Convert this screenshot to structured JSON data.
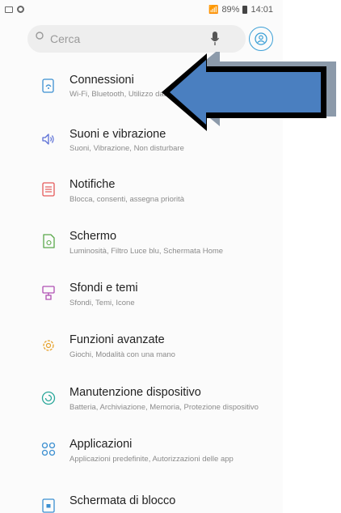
{
  "status_bar": {
    "icons": [
      "image-icon",
      "notification-dot-icon"
    ],
    "signal": "📶",
    "battery_percent": "89%",
    "time": "14:01"
  },
  "search": {
    "placeholder": "Cerca",
    "icons": [
      "search-icon",
      "microphone-icon",
      "profile-icon"
    ]
  },
  "settings_items": [
    {
      "title": "Connessioni",
      "subtitle": "Wi-Fi, Bluetooth, Utilizzo dati, Modalità offline",
      "icon": "connections-icon",
      "color": "#3b8fd1"
    },
    {
      "title": "Suoni e vibrazione",
      "subtitle": "Suoni, Vibrazione, Non disturbare",
      "icon": "sound-icon",
      "color": "#5b6fd6"
    },
    {
      "title": "Notifiche",
      "subtitle": "Blocca, consenti, assegna priorità",
      "icon": "notifications-icon",
      "color": "#e55a5a"
    },
    {
      "title": "Schermo",
      "subtitle": "Luminosità, Filtro Luce blu, Schermata Home",
      "icon": "display-icon",
      "color": "#5aa84a"
    },
    {
      "title": "Sfondi e temi",
      "subtitle": "Sfondi, Temi, Icone",
      "icon": "wallpaper-icon",
      "color": "#b04fb3"
    },
    {
      "title": "Funzioni avanzate",
      "subtitle": "Giochi, Modalità con una mano",
      "icon": "advanced-features-icon",
      "color": "#e6a12a"
    },
    {
      "title": "Manutenzione dispositivo",
      "subtitle": "Batteria, Archiviazione, Memoria, Protezione dispositivo",
      "icon": "device-maintenance-icon",
      "color": "#2aa79a"
    },
    {
      "title": "Applicazioni",
      "subtitle": "Applicazioni predefinite, Autorizzazioni delle app",
      "icon": "apps-icon",
      "color": "#3b8fd1"
    },
    {
      "title": "Schermata di blocco",
      "subtitle": "",
      "icon": "lock-screen-icon",
      "color": "#3b8fd1"
    }
  ],
  "overlay": {
    "icon": "left-arrow-annotation",
    "fill_color": "#4a7fc0",
    "shadow_color": "#8c9aaa"
  }
}
